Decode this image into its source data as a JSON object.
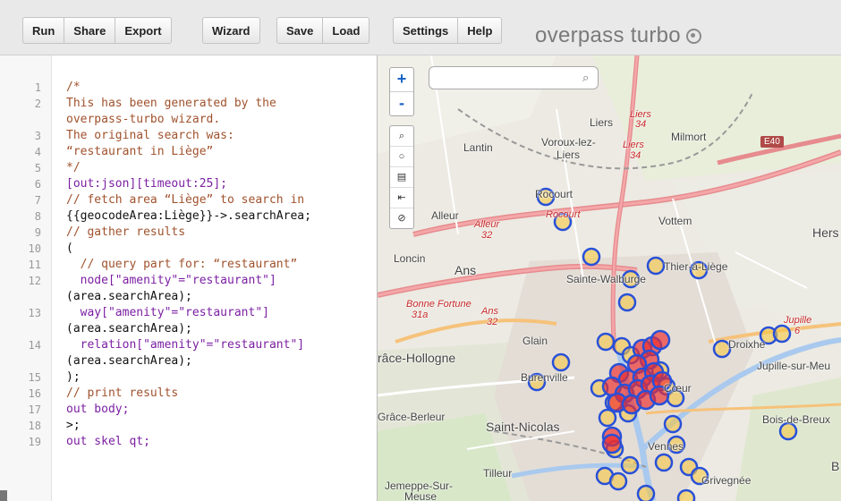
{
  "toolbar": {
    "buttons_group1": [
      "Run",
      "Share",
      "Export"
    ],
    "buttons_group2": [
      "Wizard"
    ],
    "buttons_group3": [
      "Save",
      "Load"
    ],
    "buttons_group4": [
      "Settings",
      "Help"
    ],
    "brand": "overpass turbo"
  },
  "editor": {
    "lines": [
      {
        "num": "1",
        "text": "/*"
      },
      {
        "num": "2",
        "text": "This has been generated by the"
      },
      {
        "num": "",
        "text": "overpass-turbo wizard."
      },
      {
        "num": "3",
        "text": "The original search was:"
      },
      {
        "num": "4",
        "text": "“restaurant in Liège”"
      },
      {
        "num": "5",
        "text": "*/"
      },
      {
        "num": "6",
        "text": "[out:json][timeout:25];"
      },
      {
        "num": "7",
        "text": "// fetch area “Liège” to search in"
      },
      {
        "num": "8",
        "text": "{{geocodeArea:Liège}}->.searchArea;"
      },
      {
        "num": "9",
        "text": "// gather results"
      },
      {
        "num": "10",
        "text": "("
      },
      {
        "num": "11",
        "text": "  // query part for: “restaurant”"
      },
      {
        "num": "12",
        "text": "  node[\"amenity\"=\"restaurant\"]"
      },
      {
        "num": "",
        "text": "(area.searchArea);"
      },
      {
        "num": "13",
        "text": "  way[\"amenity\"=\"restaurant\"]"
      },
      {
        "num": "",
        "text": "(area.searchArea);"
      },
      {
        "num": "14",
        "text": "  relation[\"amenity\"=\"restaurant\"]"
      },
      {
        "num": "",
        "text": "(area.searchArea);"
      },
      {
        "num": "15",
        "text": ");"
      },
      {
        "num": "16",
        "text": "// print results"
      },
      {
        "num": "17",
        "text": "out body;"
      },
      {
        "num": "18",
        "text": ">;"
      },
      {
        "num": "19",
        "text": "out skel qt;"
      }
    ]
  },
  "map": {
    "zoom_in": "+",
    "zoom_out": "-",
    "search_placeholder": "",
    "labels": {
      "liers": "Liers",
      "milmort": "Milmort",
      "lantin": "Lantin",
      "voroux": "Voroux-lez-",
      "voroux2": "Liers",
      "rocourt": "Rocourt",
      "alleur": "Alleur",
      "vottem": "Vottem",
      "herstal": "Hers",
      "loncin": "Loncin",
      "ans": "Ans",
      "sainte_walburge": "Sainte-Walburge",
      "thier": "Thier-à-Liège",
      "glain": "Glain",
      "grace": "râce-Hollogne",
      "burenville": "Burenville",
      "droixhe": "Droixhe",
      "jupille": "Jupille-sur-Meu",
      "coeur": "Cœur",
      "grace_berleur": "Grâce-Berleur",
      "saint_nicolas": "Saint-Nicolas",
      "bois_breux": "Bois-de-Breux",
      "vennes": "Vennes",
      "tilleur": "Tilleur",
      "jemeppe": "Jemeppe-Sur-",
      "jemeppe2": "Meuse",
      "grivegnee": "Grivegnée",
      "b": "B"
    },
    "roads": {
      "liers34": "Liers",
      "liers34b": "34",
      "liers34c": "Liers",
      "liers34d": "34",
      "alleur32": "Alleur",
      "alleur32b": "32",
      "rocourt": "Rocourt",
      "bonne": "Bonne Fortune",
      "bonne2": "31a",
      "ans32": "Ans",
      "ans32b": "32",
      "jupille6": "Jupille",
      "jupille6b": "6"
    },
    "shield_e40": "E40"
  }
}
